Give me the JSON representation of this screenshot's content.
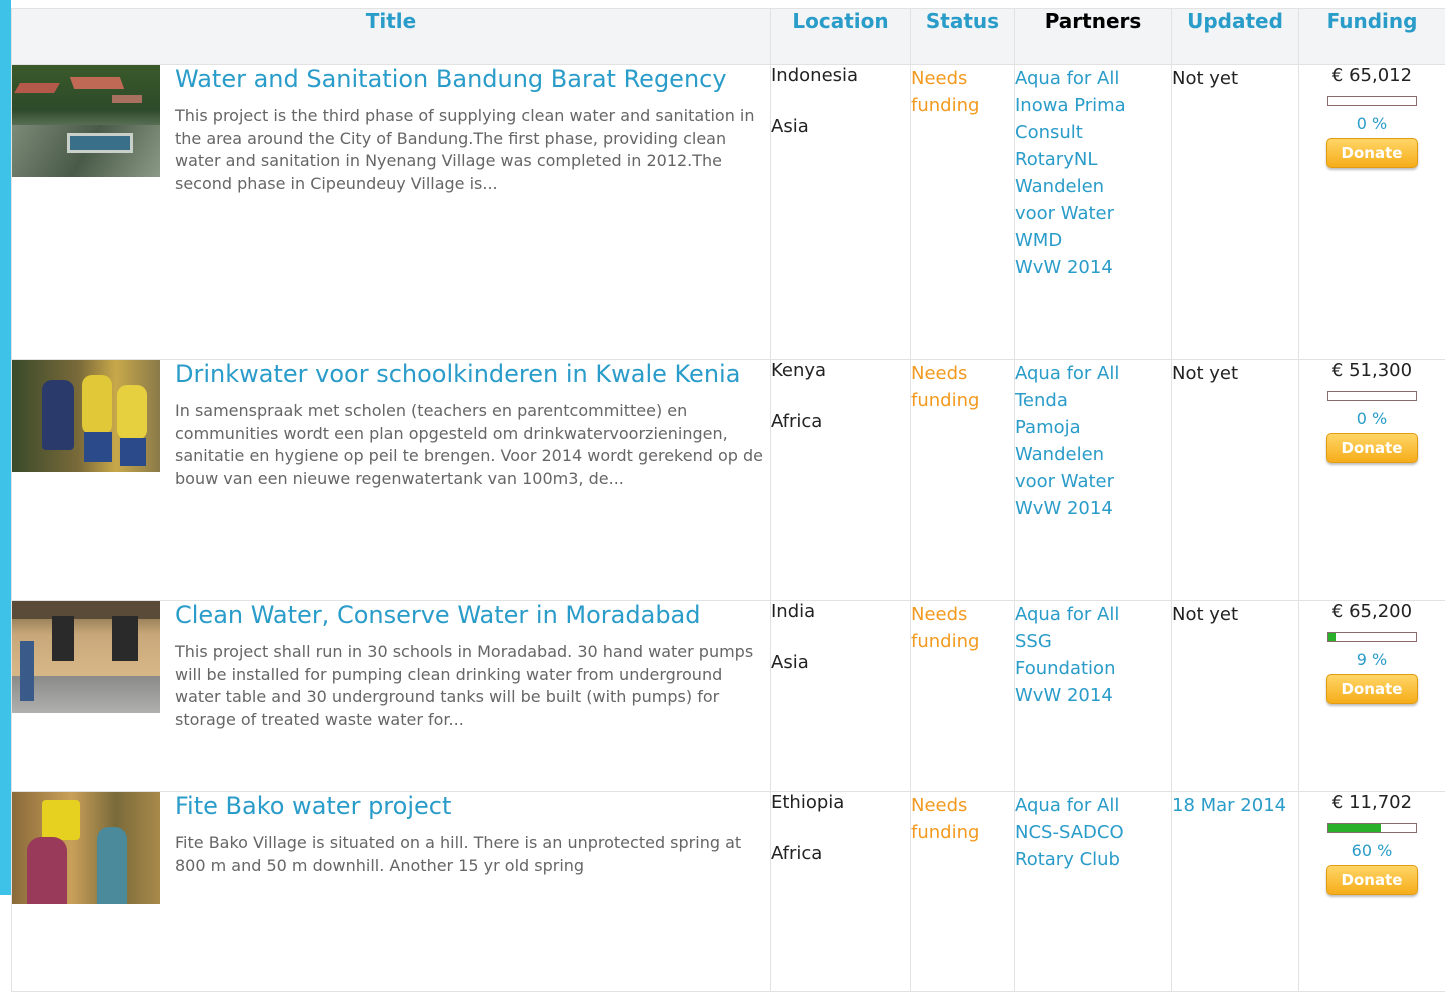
{
  "columns": {
    "title": "Title",
    "location": "Location",
    "status": "Status",
    "partners": "Partners",
    "updated": "Updated",
    "funding": "Funding"
  },
  "projects": [
    {
      "title": "Water and Sanitation Bandung Barat Regency",
      "description": "This project is the third phase of supplying clean water and sanitation in the area around the City of Bandung.The first phase, providing clean water and sanitation in Nyenang Village was completed in 2012.The second phase in Cipeundeuy Village is...",
      "country": "Indonesia",
      "region": "Asia",
      "status": "Needs funding",
      "partners": [
        "Aqua for All",
        "Inowa Prima",
        "Consult",
        "RotaryNL",
        "Wandelen",
        "voor Water",
        "WMD",
        "WvW 2014"
      ],
      "updated": "Not yet",
      "amount": "€ 65,012",
      "percent_label": "0 %",
      "percent_value": 0,
      "donate": "Donate"
    },
    {
      "title": "Drinkwater voor schoolkinderen in Kwale Kenia",
      "description": "In samenspraak met scholen (teachers en parentcommittee) en communities wordt een plan opgesteld om drinkwatervoorzieningen, sanitatie en hygiene op peil te brengen. Voor 2014 wordt gerekend op de bouw van een nieuwe regenwatertank van 100m3, de...",
      "country": "Kenya",
      "region": "Africa",
      "status": "Needs funding",
      "partners": [
        "Aqua for All",
        "Tenda",
        "Pamoja",
        "Wandelen",
        "voor Water",
        "WvW 2014"
      ],
      "updated": "Not yet",
      "amount": "€ 51,300",
      "percent_label": "0 %",
      "percent_value": 0,
      "donate": "Donate"
    },
    {
      "title": "Clean Water, Conserve Water in Moradabad",
      "description": "This project shall run in 30 schools in Moradabad. 30 hand water pumps will be installed for pumping clean drinking water from underground water table and 30 underground tanks will be built (with pumps) for storage of treated waste water for...",
      "country": "India",
      "region": "Asia",
      "status": "Needs funding",
      "partners": [
        "Aqua for All",
        "SSG",
        "Foundation",
        "WvW 2014"
      ],
      "updated": "Not yet",
      "amount": "€ 65,200",
      "percent_label": "9 %",
      "percent_value": 9,
      "donate": "Donate"
    },
    {
      "title": "Fite Bako water project",
      "description": "Fite Bako Village is situated on a hill. There is an unprotected spring at 800 m and 50 m downhill. Another 15 yr old spring",
      "country": "Ethiopia",
      "region": "Africa",
      "status": "Needs funding",
      "partners": [
        "Aqua for All",
        "NCS-SADCO",
        "Rotary Club"
      ],
      "updated": "18 Mar 2014",
      "amount": "€ 11,702",
      "percent_label": "60 %",
      "percent_value": 60,
      "donate": "Donate"
    }
  ],
  "colors": {
    "accent": "#2a9cc9",
    "status": "#f39a1e",
    "donate": "#f6ad1a",
    "progress": "#2bb02b",
    "sidebar": "#3fc2e8"
  }
}
